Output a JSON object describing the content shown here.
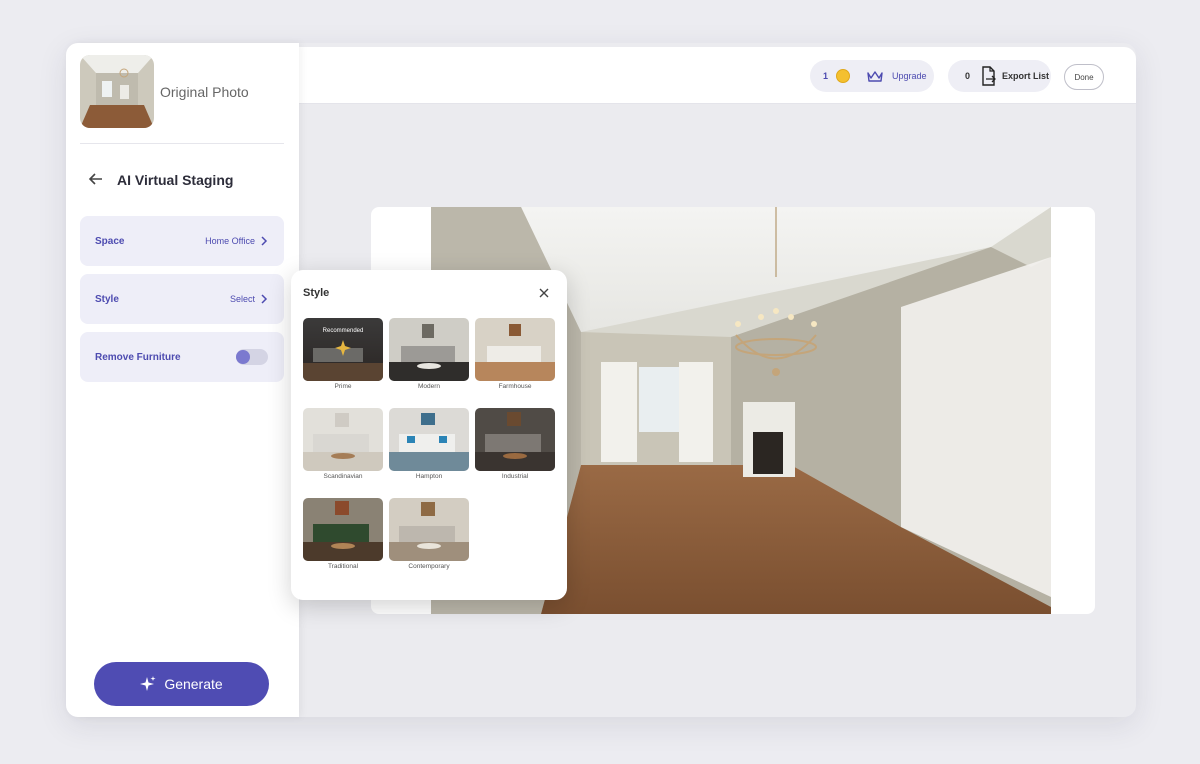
{
  "sidebar": {
    "original_photo_label": "Original Photo",
    "title": "AI Virtual Staging",
    "rows": [
      {
        "label": "Space",
        "value": "Home Office"
      },
      {
        "label": "Style",
        "value": "Select"
      },
      {
        "label": "Remove Furniture",
        "toggle_on": false
      }
    ],
    "generate_label": "Generate"
  },
  "topbar": {
    "credits": "1",
    "upgrade_label": "Upgrade",
    "export_count": "0",
    "export_label": "Export List",
    "done_label": "Done"
  },
  "style_popup": {
    "title": "Style",
    "recommended_badge": "Recommended",
    "styles": [
      "Prime",
      "Modern",
      "Farmhouse",
      "Scandinavian",
      "Hampton",
      "Industrial",
      "Traditional",
      "Contemporary"
    ]
  },
  "colors": {
    "accent": "#4f4cb3",
    "row_bg": "#eeeef8",
    "coin": "#f4c02f"
  },
  "icons": [
    "back-arrow-icon",
    "chevron-right-icon",
    "coin-icon",
    "crown-icon",
    "export-file-icon",
    "close-icon",
    "sparkle-icon"
  ]
}
